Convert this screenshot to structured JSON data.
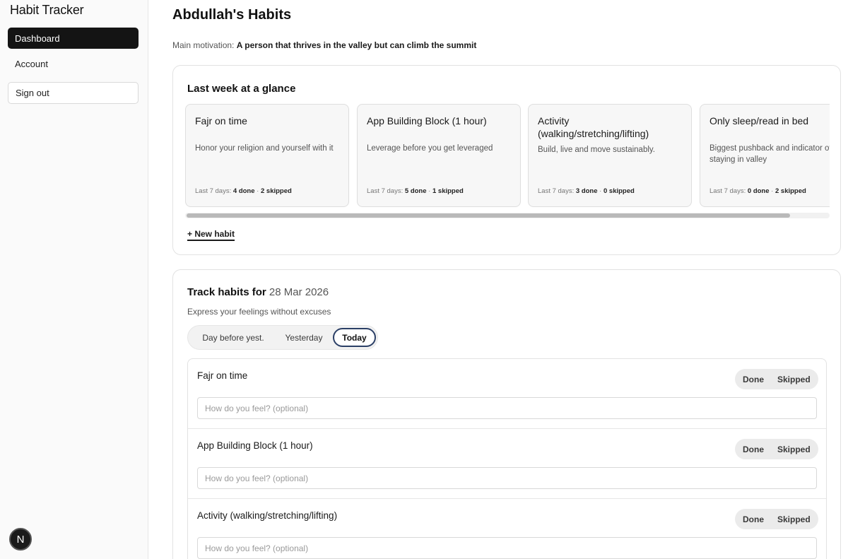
{
  "sidebar": {
    "brand": "Habit Tracker",
    "items": [
      {
        "label": "Dashboard"
      },
      {
        "label": "Account"
      }
    ],
    "signout_label": "Sign out",
    "badge": "N"
  },
  "header": {
    "title": "Abdullah's Habits",
    "motivation_label": "Main motivation:",
    "motivation_value": "A person that thrives in the valley but can climb the summit"
  },
  "week": {
    "title": "Last week at a glance",
    "stats_prefix": "Last 7 days:",
    "done_suffix": "done",
    "skipped_suffix": "skipped",
    "separator": "·",
    "scroll_fraction": 0.94,
    "cards": [
      {
        "title": "Fajr on time",
        "description": "Honor your religion and yourself with it",
        "done": "4",
        "skipped": "2"
      },
      {
        "title": "App Building Block (1 hour)",
        "description": "Leverage before you get leveraged",
        "done": "5",
        "skipped": "1"
      },
      {
        "title": "Activity (walking/stretching/lifting)",
        "description": "Build, live and move sustainably.",
        "done": "3",
        "skipped": "0"
      },
      {
        "title": "Only sleep/read in bed",
        "description": "Biggest pushback and indicator of staying in valley",
        "done": "0",
        "skipped": "2"
      }
    ],
    "new_habit_label": "+ New habit"
  },
  "track": {
    "title": "Track habits for",
    "date": "28 Mar 2026",
    "subtitle": "Express your feelings without excuses",
    "tabs": [
      {
        "label": "Day before yest."
      },
      {
        "label": "Yesterday"
      },
      {
        "label": "Today"
      }
    ],
    "active_tab": "Today",
    "done_label": "Done",
    "skipped_label": "Skipped",
    "input_placeholder": "How do you feel? (optional)",
    "habits": [
      {
        "name": "Fajr on time"
      },
      {
        "name": "App Building Block (1 hour)"
      },
      {
        "name": "Activity (walking/stretching/lifting)"
      }
    ]
  },
  "colors": {
    "sidebar_active": "#141414",
    "active_tab_border": "#2b3f66",
    "card_bg": "#f7f7f7"
  },
  "icons": {
    "badge": "n-letter-icon"
  }
}
